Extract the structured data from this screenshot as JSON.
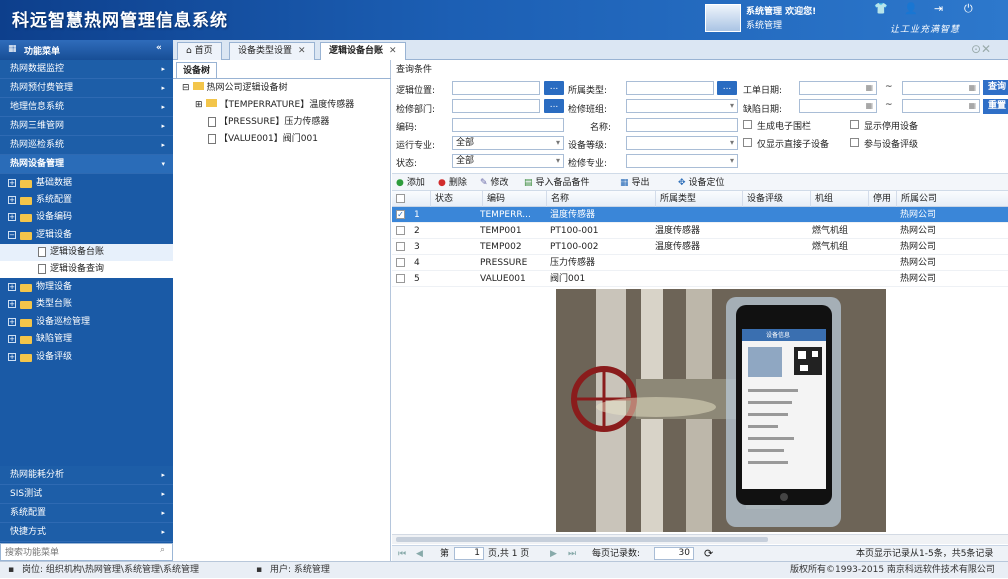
{
  "header": {
    "title": "科远智慧热网管理信息系统",
    "user_welcome": "系统管理 欢迎您!",
    "user_role": "系统管理",
    "slogan": "让工业充满智慧",
    "icons": [
      "shirt-icon",
      "user-icon",
      "logout-icon",
      "exit-icon"
    ]
  },
  "sidebar": {
    "title": "功能菜单",
    "top_items": [
      {
        "label": "热网数据监控"
      },
      {
        "label": "热网预付费管理"
      },
      {
        "label": "地理信息系统"
      },
      {
        "label": "热网三维管网"
      },
      {
        "label": "热网巡检系统"
      },
      {
        "label": "热网设备管理"
      }
    ],
    "tree": [
      "基础数据",
      "系统配置",
      "设备编码",
      "逻辑设备",
      "逻辑设备台账",
      "逻辑设备查询",
      "物理设备",
      "类型台账",
      "设备巡检管理",
      "缺陷管理",
      "设备评级"
    ],
    "bottom_items": [
      {
        "label": "热网能耗分析"
      },
      {
        "label": "SIS测试"
      },
      {
        "label": "系统配置"
      },
      {
        "label": "快捷方式"
      }
    ],
    "search_placeholder": "搜索功能菜单"
  },
  "tabs": [
    {
      "label": "首页"
    },
    {
      "label": "设备类型设置"
    },
    {
      "label": "逻辑设备台账"
    }
  ],
  "tree_panel": {
    "tab": "设备树",
    "root": "热网公司逻辑设备树",
    "nodes": [
      "【TEMPERRATURE】温度传感器",
      "【PRESSURE】压力传感器",
      "【VALUE001】阀门001"
    ]
  },
  "query": {
    "title": "查询条件",
    "labels": {
      "location": "逻辑位置:",
      "type": "所属类型:",
      "work_date": "工单日期:",
      "dept": "检修部门:",
      "team": "检修班组:",
      "defect_date": "缺陷日期:",
      "code": "编码:",
      "name": "名称:",
      "major": "运行专业:",
      "level": "设备等级:",
      "status": "状态:",
      "repair_major": "检修专业:"
    },
    "selects": {
      "major": "全部",
      "status": "全部"
    },
    "checkboxes": [
      "生成电子围栏",
      "显示停用设备",
      "仅显示直接子设备",
      "参与设备评级"
    ],
    "buttons": {
      "dots": "...",
      "search": "查询",
      "reset": "重置",
      "tilde": "~"
    }
  },
  "grid_toolbar": {
    "add": "添加",
    "delete": "删除",
    "edit": "修改",
    "import": "导入备品备件",
    "export": "导出",
    "locate": "设备定位"
  },
  "grid": {
    "columns": [
      "状态",
      "编码",
      "名称",
      "所属类型",
      "设备评级",
      "机组",
      "停用",
      "所属公司"
    ],
    "rows": [
      {
        "no": "1",
        "code": "TEMPERR...",
        "name": "温度传感器",
        "type": "",
        "unit": "",
        "company": "热网公司"
      },
      {
        "no": "2",
        "code": "TEMP001",
        "name": "PT100-001",
        "type": "温度传感器",
        "unit": "燃气机组",
        "company": "热网公司"
      },
      {
        "no": "3",
        "code": "TEMP002",
        "name": "PT100-002",
        "type": "温度传感器",
        "unit": "燃气机组",
        "company": "热网公司"
      },
      {
        "no": "4",
        "code": "PRESSURE",
        "name": "压力传感器",
        "type": "",
        "unit": "",
        "company": "热网公司"
      },
      {
        "no": "5",
        "code": "VALUE001",
        "name": "阀门001",
        "type": "",
        "unit": "",
        "company": "热网公司"
      }
    ]
  },
  "phone": {
    "header": "设备信息"
  },
  "pager": {
    "page_label": "第",
    "page": "1",
    "total": "页,共 1 页",
    "per_page_label": "每页记录数:",
    "per_page": "30",
    "summary": "本页显示记录从1-5条，共5条记录"
  },
  "status": {
    "position": "岗位: 组织机构\\热网管理\\系统管理\\系统管理",
    "user": "用户: 系统管理",
    "copyright": "版权所有©1993-2015 南京科远软件技术有限公司"
  }
}
